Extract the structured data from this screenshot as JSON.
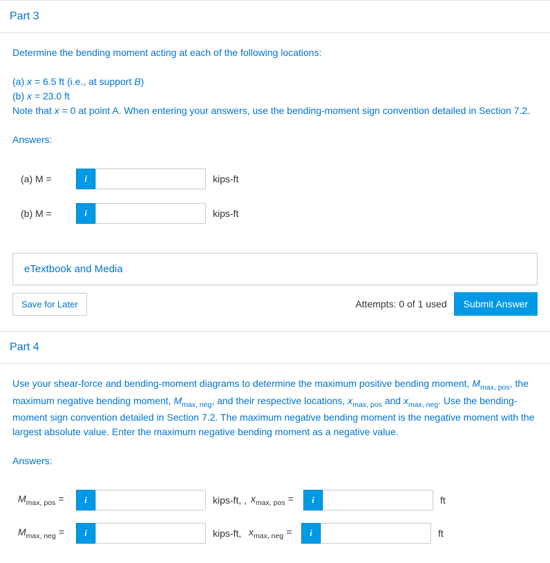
{
  "part3": {
    "title": "Part 3",
    "intro": "Determine the bending moment acting at each of the following locations:",
    "line_a_prefix": "(a) ",
    "line_a_x": "x",
    "line_a_rest": " = 6.5 ft (i.e., at support ",
    "line_a_b": "B",
    "line_a_close": ")",
    "line_b_prefix": "(b) ",
    "line_b_x": "x",
    "line_b_rest": " = 23.0 ft",
    "note_prefix": "Note that ",
    "note_x": "x",
    "note_rest": " = 0 at point A.   When entering your answers, use the bending-moment sign convention detailed in Section 7.2.",
    "answers_label": "Answers:",
    "row_a_label": "(a)    M =",
    "row_b_label": "(b)    M =",
    "unit": "kips-ft",
    "etext": "eTextbook and Media",
    "save": "Save for Later",
    "attempts": "Attempts: 0 of 1 used",
    "submit": "Submit Answer"
  },
  "part4": {
    "title": "Part 4",
    "body_1": "Use your shear-force and bending-moment diagrams to determine the maximum positive bending moment, ",
    "m_max_pos": "M",
    "m_max_pos_sub": "max, pos",
    "body_2": ", the maximum negative bending moment, ",
    "m_max_neg": "M",
    "m_max_neg_sub": "max, neg",
    "body_3": ", and their respective locations, ",
    "x_max_pos": "x",
    "x_max_pos_sub": "max, pos",
    "body_4": " and ",
    "x_max_neg": "x",
    "x_max_neg_sub": "max, neg",
    "body_5": ". Use the bending-moment sign convention detailed in Section 7.2. The maximum negative bending moment is the negative moment with the largest absolute value. Enter the maximum negative bending moment as a negative value.",
    "answers_label": "Answers:",
    "row1_m_label": "M",
    "row1_m_sub": "max, pos",
    "row1_eq": " =",
    "row1_unit": "kips-ft, ,",
    "row1_x_label": "x",
    "row1_x_sub": "max, pos",
    "row1_x_eq": " =",
    "row1_x_unit": "ft",
    "row2_m_label": "M",
    "row2_m_sub": "max, neg",
    "row2_eq": " =",
    "row2_unit": "kips-ft,",
    "row2_x_label": "x",
    "row2_x_sub": "max, neg",
    "row2_x_eq": " =",
    "row2_x_unit": "ft"
  }
}
